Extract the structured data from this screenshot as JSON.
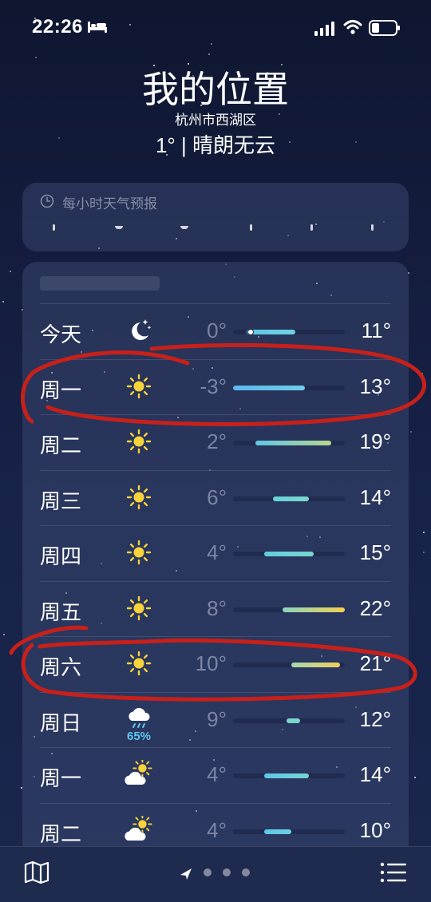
{
  "status_bar": {
    "time": "22:26",
    "sleep_icon": "bed-icon",
    "signal_icon": "cellular-signal-icon",
    "wifi_icon": "wifi-icon",
    "battery_icon": "battery-icon"
  },
  "header": {
    "title": "我的位置",
    "subtitle": "杭州市西湖区",
    "conditions": "1° | 晴朗无云"
  },
  "hourly": {
    "label": "每小时天气预报",
    "icon": "clock-icon"
  },
  "daily": {
    "scale": {
      "min": -3,
      "max": 22
    },
    "current_temp": 1,
    "days": [
      {
        "day": "今天",
        "icon": "moon-stars-icon",
        "low": "0°",
        "high": "11°",
        "low_val": 0,
        "high_val": 11,
        "color_from": "#5ec8e8",
        "color_to": "#6fd0e0"
      },
      {
        "day": "周一",
        "icon": "sun-icon",
        "low": "-3°",
        "high": "13°",
        "low_val": -3,
        "high_val": 13,
        "color_from": "#5cb8f0",
        "color_to": "#6ccfe6"
      },
      {
        "day": "周二",
        "icon": "sun-icon",
        "low": "2°",
        "high": "19°",
        "low_val": 2,
        "high_val": 19,
        "color_from": "#5fc8e6",
        "color_to": "#b7d68e"
      },
      {
        "day": "周三",
        "icon": "sun-icon",
        "low": "6°",
        "high": "14°",
        "low_val": 6,
        "high_val": 14,
        "color_from": "#6ad2d8",
        "color_to": "#7ad7cc"
      },
      {
        "day": "周四",
        "icon": "sun-icon",
        "low": "4°",
        "high": "15°",
        "low_val": 4,
        "high_val": 15,
        "color_from": "#62cde2",
        "color_to": "#7ad6cc"
      },
      {
        "day": "周五",
        "icon": "sun-icon",
        "low": "8°",
        "high": "22°",
        "low_val": 8,
        "high_val": 22,
        "color_from": "#8ad6c0",
        "color_to": "#f3cf4e"
      },
      {
        "day": "周六",
        "icon": "sun-icon",
        "low": "10°",
        "high": "21°",
        "low_val": 10,
        "high_val": 21,
        "color_from": "#a7d8b0",
        "color_to": "#efcf5a"
      },
      {
        "day": "周日",
        "icon": "rain-cloud-icon",
        "precip": "65%",
        "low": "9°",
        "high": "12°",
        "low_val": 9,
        "high_val": 12,
        "color_from": "#7ad6cc",
        "color_to": "#7ad6cc"
      },
      {
        "day": "周一",
        "icon": "partly-sunny-icon",
        "low": "4°",
        "high": "14°",
        "low_val": 4,
        "high_val": 14,
        "color_from": "#5ec8e8",
        "color_to": "#74d4d4"
      },
      {
        "day": "周二",
        "icon": "partly-sunny-icon",
        "low": "4°",
        "high": "10°",
        "low_val": 4,
        "high_val": 10,
        "color_from": "#5ec8e8",
        "color_to": "#6ccfe0"
      }
    ]
  },
  "annotations": {
    "color": "#c8201a",
    "circled_rows": [
      "周一",
      "周六"
    ]
  },
  "bottom_bar": {
    "map_icon": "map-icon",
    "location_icon": "location-arrow-icon",
    "list_icon": "list-icon",
    "page_count": 3
  }
}
